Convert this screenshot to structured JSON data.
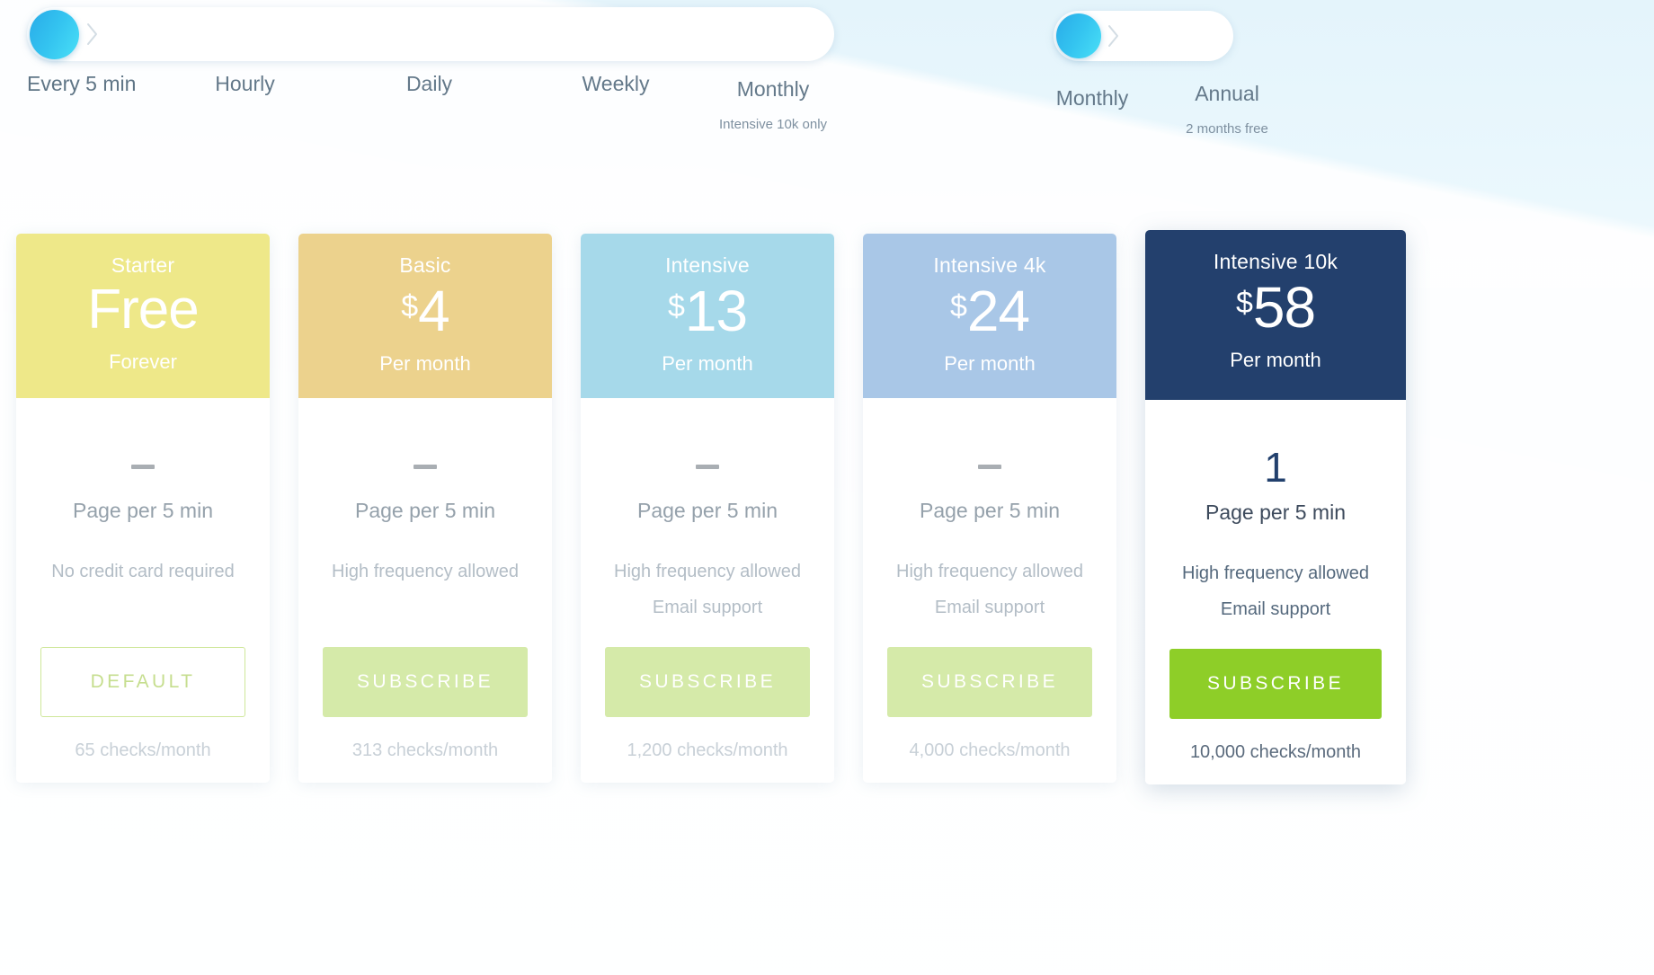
{
  "frequency_slider": {
    "name": "check-frequency-slider",
    "knob_color": "#34c4f0",
    "selected": "Every 5 min",
    "options": [
      {
        "label": "Every 5 min",
        "sub": ""
      },
      {
        "label": "Hourly",
        "sub": ""
      },
      {
        "label": "Daily",
        "sub": ""
      },
      {
        "label": "Weekly",
        "sub": ""
      },
      {
        "label": "Monthly",
        "sub": "Intensive 10k only"
      }
    ]
  },
  "billing_toggle": {
    "name": "billing-period-toggle",
    "knob_color": "#34c4f0",
    "selected": "Monthly",
    "options": [
      {
        "label": "Monthly",
        "sub": ""
      },
      {
        "label": "Annual",
        "sub": "2 months free"
      }
    ]
  },
  "plans": [
    {
      "name": "Starter",
      "currency": "",
      "amount": "Free",
      "period": "Forever",
      "header_color": "#eee889",
      "quota": "–",
      "quota_is_dash": true,
      "quota_label": "Page per 5 min",
      "features": [
        "No credit card required"
      ],
      "cta_label": "DEFAULT",
      "cta_style": "ghost",
      "checks": "65 checks/month",
      "featured": false
    },
    {
      "name": "Basic",
      "currency": "$",
      "amount": "4",
      "period": "Per month",
      "header_color": "#ecd28d",
      "quota": "–",
      "quota_is_dash": true,
      "quota_label": "Page per 5 min",
      "features": [
        "High frequency allowed"
      ],
      "cta_label": "SUBSCRIBE",
      "cta_style": "muted",
      "checks": "313 checks/month",
      "featured": false
    },
    {
      "name": "Intensive",
      "currency": "$",
      "amount": "13",
      "period": "Per month",
      "header_color": "#a6d9ea",
      "quota": "–",
      "quota_is_dash": true,
      "quota_label": "Page per 5 min",
      "features": [
        "High frequency allowed",
        "Email support"
      ],
      "cta_label": "SUBSCRIBE",
      "cta_style": "muted",
      "checks": "1,200 checks/month",
      "featured": false
    },
    {
      "name": "Intensive 4k",
      "currency": "$",
      "amount": "24",
      "period": "Per month",
      "header_color": "#a9c7e7",
      "quota": "–",
      "quota_is_dash": true,
      "quota_label": "Page per 5 min",
      "features": [
        "High frequency allowed",
        "Email support"
      ],
      "cta_label": "SUBSCRIBE",
      "cta_style": "muted",
      "checks": "4,000 checks/month",
      "featured": false
    },
    {
      "name": "Intensive 10k",
      "currency": "$",
      "amount": "58",
      "period": "Per month",
      "header_color": "#23406d",
      "quota": "1",
      "quota_is_dash": false,
      "quota_label": "Page per 5 min",
      "features": [
        "High frequency allowed",
        "Email support"
      ],
      "cta_label": "SUBSCRIBE",
      "cta_style": "primary",
      "checks": "10,000 checks/month",
      "featured": true
    }
  ]
}
